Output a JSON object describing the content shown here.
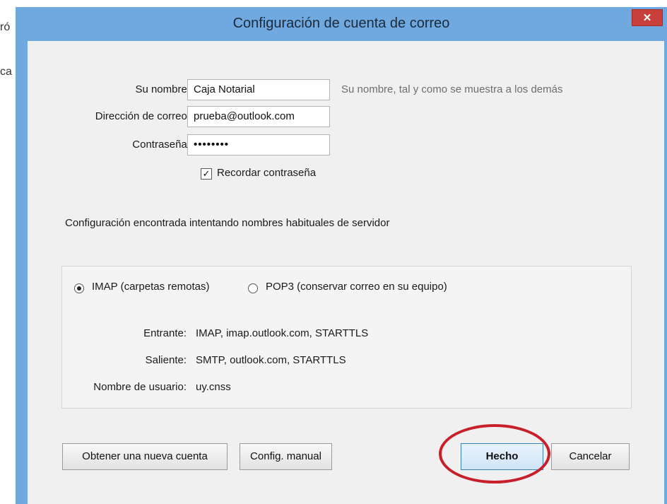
{
  "background": {
    "fragment_1": "ró",
    "fragment_2": "ca"
  },
  "window": {
    "title": "Configuración de cuenta de correo",
    "close_glyph": "✕"
  },
  "form": {
    "name_label": "Su nombre:",
    "name_value": "Caja Notarial",
    "name_hint": "Su nombre, tal y como se muestra a los demás",
    "email_label": "Dirección de correo:",
    "email_value": "prueba@outlook.com",
    "password_label": "Contraseña:",
    "password_value": "••••••••",
    "remember_label": "Recordar contraseña",
    "remember_checked": true
  },
  "found_message": "Configuración encontrada intentando nombres habituales de servidor",
  "protocol": {
    "imap_label": "IMAP (carpetas remotas)",
    "pop3_label": "POP3 (conservar correo en su equipo)",
    "selected": "imap"
  },
  "server_info": {
    "incoming_label": "Entrante:",
    "incoming_value": "IMAP, imap.outlook.com, STARTTLS",
    "outgoing_label": "Saliente:",
    "outgoing_value": "SMTP, outlook.com, STARTTLS",
    "username_label": "Nombre de usuario:",
    "username_value": "uy.cnss"
  },
  "buttons": {
    "new_account": "Obtener una nueva cuenta",
    "manual_config": "Config. manual",
    "done": "Hecho",
    "cancel": "Cancelar"
  },
  "colors": {
    "title_bar": "#6fa9df",
    "close_button": "#c9403a",
    "highlight": "#c8202a"
  }
}
